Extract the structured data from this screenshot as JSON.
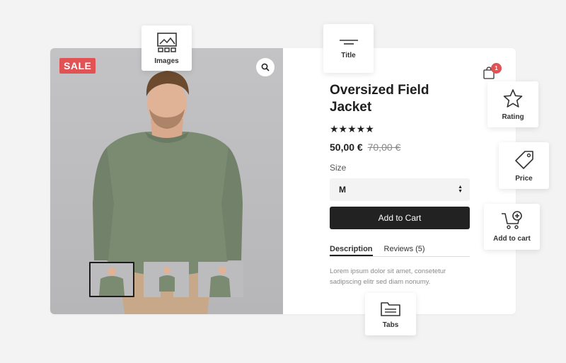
{
  "product": {
    "sale_badge": "SALE",
    "title": "Oversized Field Jacket",
    "rating_stars": "★★★★★",
    "price": "50,00 €",
    "old_price": "70,00 €",
    "size_label": "Size",
    "size_selected": "M",
    "add_to_cart": "Add to Cart",
    "tabs": [
      "Description",
      "Reviews (5)"
    ],
    "description": "Lorem ipsum dolor sit amet, consetetur sadipscing elitr sed diam nonumy."
  },
  "cart": {
    "count": "1",
    "icon": "shopping-bag-icon"
  },
  "feature_tiles": {
    "images": "Images",
    "title": "Title",
    "rating": "Rating",
    "price": "Price",
    "add_to_cart": "Add to cart",
    "tabs": "Tabs"
  },
  "colors": {
    "sale": "#e05254",
    "button": "#222222",
    "sweater": "#7a8a72"
  }
}
